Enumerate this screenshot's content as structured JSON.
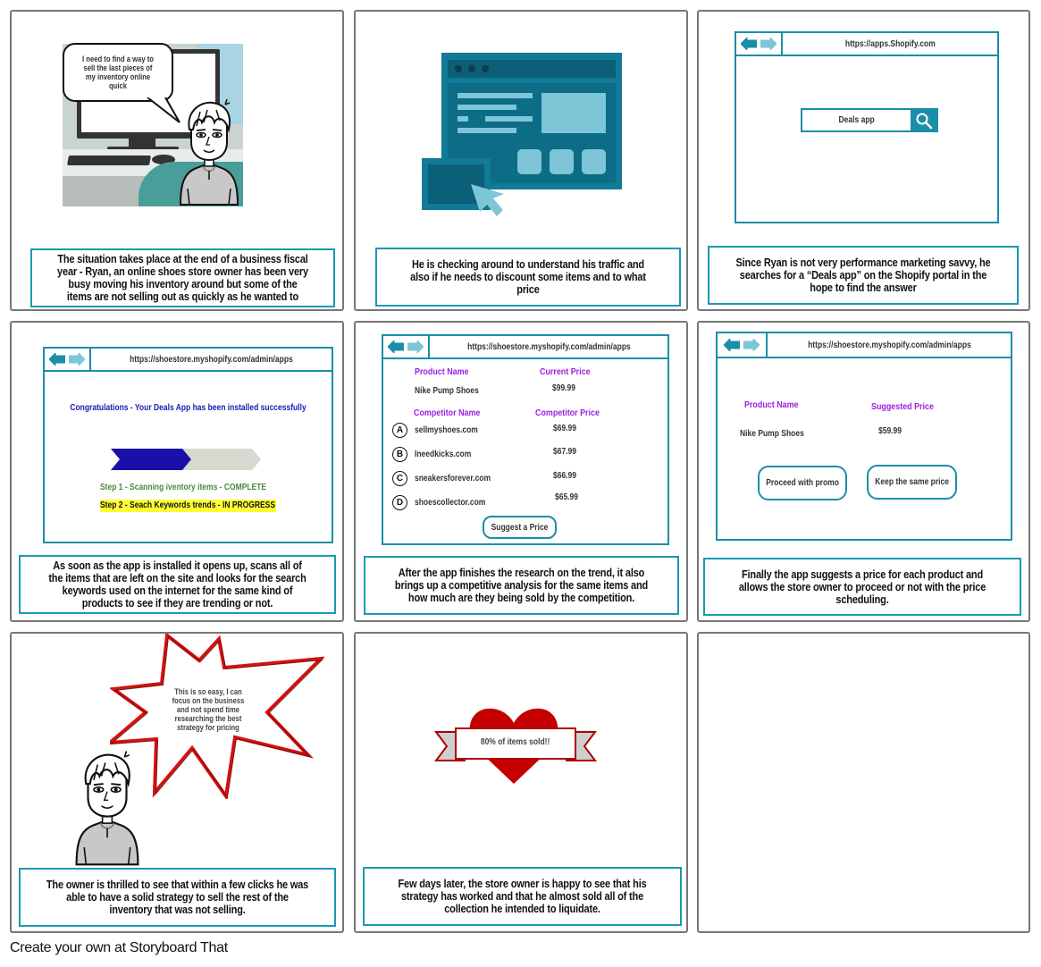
{
  "storyboard": {
    "footer": "Create your own at Storyboard That",
    "colors": {
      "panel_border": "#777777",
      "caption_border": "#1a9ab0",
      "browser_teal": "#1a8ea8",
      "accent_light_teal": "#7cc6d8",
      "purple_heading": "#9b1ee0",
      "blue_text": "#1a1ab4",
      "green_text": "#4a8a3a",
      "highlight_yellow": "#ffff33",
      "heart_red": "#c40000"
    },
    "panels": [
      {
        "id": 1,
        "speech": "I need to find a way to sell the last pieces of my inventory online quick",
        "caption": "The situation takes place at the end of a business fiscal year - Ryan, an online shoes store owner has been very busy moving his inventory around but some of the items are not selling out as quickly as he wanted to"
      },
      {
        "id": 2,
        "caption": "He is checking around to understand his traffic and also if he needs to discount some items and to what price"
      },
      {
        "id": 3,
        "url": "https://apps.Shopify.com",
        "search_value": "Deals app",
        "caption": "Since Ryan is not very performance marketing savvy, he searches for a “Deals app” on the Shopify portal in the hope to find the answer"
      },
      {
        "id": 4,
        "url": "https://shoestore.myshopify.com/admin/apps",
        "congrats": "Congratulations - Your Deals App has been installed successfully",
        "progress": {
          "steps_total": 2,
          "steps_complete": 1
        },
        "step1": "Step 1 - Scanning iventory items - COMPLETE",
        "step2": "Step 2 - Seach Keywords trends - IN PROGRESS",
        "caption": "As soon as the app is installed it opens up, scans all of the items that are left on the site and looks for the search keywords used on the internet for the same kind of products to see if they are trending or not."
      },
      {
        "id": 5,
        "url": "https://shoestore.myshopify.com/admin/apps",
        "product_header": "Product Name",
        "current_price_header": "Current Price",
        "product_name": "Nike Pump Shoes",
        "current_price": "$99.99",
        "competitor_header": "Competitor Name",
        "competitor_price_header": "Competitor Price",
        "competitors": [
          {
            "letter": "A",
            "name": "sellmyshoes.com",
            "price": "$69.99"
          },
          {
            "letter": "B",
            "name": "Ineedkicks.com",
            "price": "$67.99"
          },
          {
            "letter": "C",
            "name": "sneakersforever.com",
            "price": "$66.99"
          },
          {
            "letter": "D",
            "name": "shoescollector.com",
            "price": "$65.99"
          }
        ],
        "button": "Suggest a Price",
        "caption": "After the app finishes the research on the trend, it also brings up a competitive analysis for the same items and how much are they being sold by the competition."
      },
      {
        "id": 6,
        "url": "https://shoestore.myshopify.com/admin/apps",
        "product_header": "Product Name",
        "suggested_header": "Suggested Price",
        "product_name": "Nike Pump Shoes",
        "suggested_price": "$59.99",
        "button_proceed": "Proceed with promo",
        "button_keep": "Keep the same price",
        "caption": "Finally the app suggests a price for each product and allows the store owner to proceed or not with the price scheduling."
      },
      {
        "id": 7,
        "speech": "This is so easy, I can focus on the business and not spend time researching the best strategy for pricing",
        "caption": "The owner is thrilled to see that within a few clicks he was able to have a solid strategy to sell the rest of the inventory that was not selling."
      },
      {
        "id": 8,
        "banner": "80% of items sold!!",
        "caption": "Few days later, the store owner is happy to see that his strategy has worked and that he almost sold all of the collection he intended to liquidate."
      },
      {
        "id": 9
      }
    ]
  }
}
